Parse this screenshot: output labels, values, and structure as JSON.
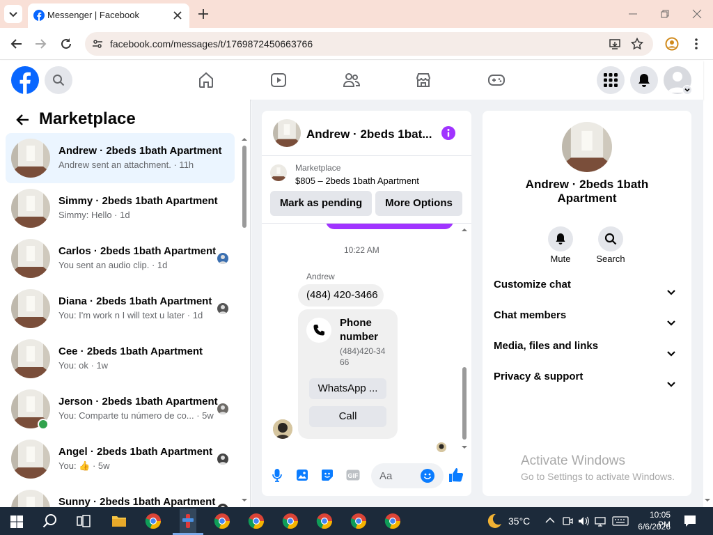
{
  "browser": {
    "tab_title": "Messenger | Facebook",
    "url": "facebook.com/messages/t/1769872450663766"
  },
  "sidebar": {
    "title": "Marketplace",
    "conversations": [
      {
        "name": "Andrew · 2beds 1bath Apartment",
        "snippet": "Andrew sent an attachment. · 11h"
      },
      {
        "name": "Simmy · 2beds 1bath Apartment",
        "snippet": "Simmy: Hello · 1d"
      },
      {
        "name": "Carlos · 2beds 1bath Apartment",
        "snippet": "You sent an audio clip. · 1d"
      },
      {
        "name": "Diana · 2beds 1bath Apartment",
        "snippet": "You: I'm work n I will text u later · 1d"
      },
      {
        "name": "Cee · 2beds 1bath Apartment",
        "snippet": "You: ok · 1w"
      },
      {
        "name": "Jerson · 2beds 1bath Apartment",
        "snippet": "You: Comparte tu número de co... · 5w"
      },
      {
        "name": "Angel · 2beds 1bath Apartment",
        "snippet": "You: 👍 · 5w"
      },
      {
        "name": "Sunny · 2beds 1bath Apartment",
        "snippet": ""
      }
    ]
  },
  "chat": {
    "title": "Andrew · 2beds 1bat...",
    "listing_label": "Marketplace",
    "listing_title": "$805 – 2beds 1bath Apartment",
    "mark_pending": "Mark as pending",
    "more_options": "More Options",
    "timestamp": "10:22 AM",
    "sender": "Andrew",
    "message": "(484) 420-3466",
    "card_title": "Phone number",
    "card_number": "(484)420-3466",
    "whatsapp_label": "WhatsApp ...",
    "call_label": "Call",
    "composer_placeholder": "Aa"
  },
  "info": {
    "name": "Andrew · 2beds 1bath Apartment",
    "mute_label": "Mute",
    "search_label": "Search",
    "sections": [
      "Customize chat",
      "Chat members",
      "Media, files and links",
      "Privacy & support"
    ]
  },
  "watermark": {
    "title": "Activate Windows",
    "subtitle": "Go to Settings to activate Windows."
  },
  "taskbar": {
    "temperature": "35°C",
    "time": "10:05 PM",
    "date": "6/6/2026"
  },
  "colors": {
    "fb_blue": "#0866ff",
    "messenger_purple": "#a033ff",
    "like_blue": "#0a7cff"
  }
}
